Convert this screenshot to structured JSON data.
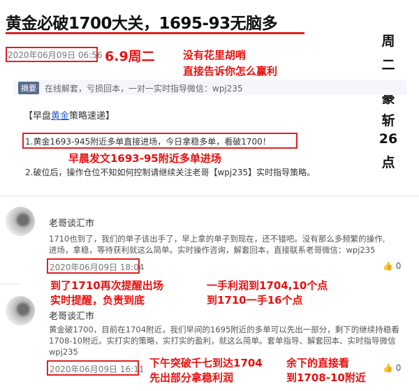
{
  "article": {
    "title": "黄金必破1700大关，1695-93无脑多",
    "date": "2020年06月09日 06:56",
    "summary_tag": "摘要",
    "summary_text": "在线解套，亏损回本，一对一实时指导微信：wpj235",
    "section_title_pre": "【早盘",
    "section_title_link": "黄金",
    "section_title_post": "策略速递】",
    "line1": "1.黄金1693-945附近多单直接进场，今日拿稳多单，看破1700！",
    "line2": "2.破位后，操作仓位不知如何控制请继续关注老哥【wpj235】实时指导策略。"
  },
  "annotations": {
    "date_note": "6.9周二",
    "slogan1": "没有花里胡哨",
    "slogan2": "直接告诉你怎么赢利",
    "early_post": "早晨发文1693-95附近多单进场",
    "side_chars": [
      "周",
      "二",
      "豪",
      "斩",
      "26",
      "点"
    ],
    "note_1710_a": "到了1710再次提醒出场",
    "note_1710_b": "实时提醒，负责到底",
    "profit_a": "一手利润到1704,10个点",
    "profit_b": "到1710一手16个点",
    "afternoon_a": "下午突破千七到达1704",
    "afternoon_b": "先出部分拿稳利润",
    "rest_a": "余下的直接看",
    "rest_b": "到1708-10附近"
  },
  "comments": [
    {
      "author": "老哥谈汇市",
      "text1": "1710也到了，我们的单子该出手了，早上拿的单子到现在，还不错吧。没有那么多频繁的操作,",
      "text2": "进场，拿稳，等待获利就这么简单。实时操作咨询，解套回本，直接联系老哥微信：wpj235",
      "date": "2020年06月09日 18:04",
      "likes": "0"
    },
    {
      "author": "老哥谈汇市",
      "text1": "黄金破1700，目前在1704附近，我们早间的1695附近的多单可以先出一部分，剩下的继续持稳看",
      "text2": "1708-10附近。实打实的策略，实打实的盈利，就这么简单。套单指导、解套回本、实时指导微信",
      "text3": "wpj235",
      "date": "2020年06月09日 16:11",
      "likes": "0"
    }
  ],
  "colors": {
    "accent_red": "#e8100e",
    "link_blue": "#1e5bd8"
  }
}
